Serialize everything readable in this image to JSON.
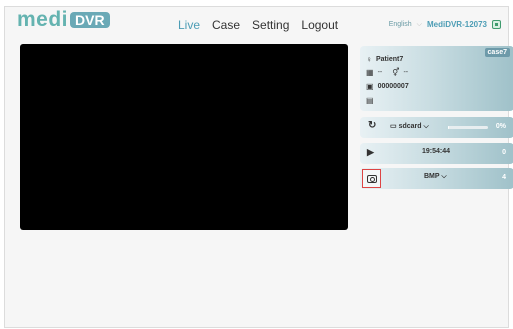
{
  "brand": {
    "part1": "medi",
    "part2": "DVR"
  },
  "nav": {
    "live": "Live",
    "case": "Case",
    "setting": "Setting",
    "logout": "Logout"
  },
  "header": {
    "language": "English",
    "device": "MediDVR-12073"
  },
  "patient": {
    "case_tag": "case7",
    "name": "Patient7",
    "birth": "--",
    "gender": "--",
    "id": "00000007"
  },
  "storage": {
    "label": "sdcard",
    "percent": "0%",
    "fill_fraction": 0.0
  },
  "record": {
    "time": "19:54:44",
    "count": "0"
  },
  "snapshot": {
    "format": "BMP",
    "count": "4"
  },
  "colors": {
    "accent": "#4d9db5",
    "logo": "#64b3b0",
    "panel": "#9fc1c9"
  }
}
